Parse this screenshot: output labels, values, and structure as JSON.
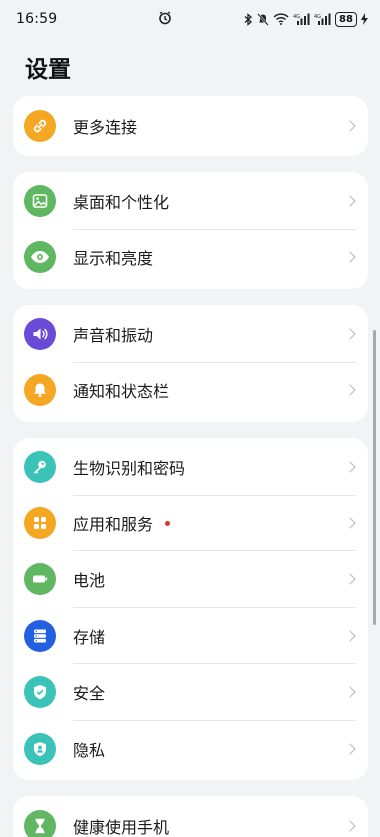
{
  "status_bar": {
    "time": "16:59",
    "battery": "88",
    "icons": [
      "alarm-icon",
      "bluetooth-icon",
      "mute-icon",
      "wifi-icon",
      "signal-icon",
      "signal-icon",
      "charging-icon"
    ]
  },
  "page": {
    "title": "设置"
  },
  "groups": [
    {
      "items": [
        {
          "label": "更多连接",
          "icon": "link-icon",
          "color": "#f5a623"
        }
      ]
    },
    {
      "items": [
        {
          "label": "桌面和个性化",
          "icon": "image-icon",
          "color": "#5fb761"
        },
        {
          "label": "显示和亮度",
          "icon": "eye-icon",
          "color": "#5fb761"
        }
      ]
    },
    {
      "items": [
        {
          "label": "声音和振动",
          "icon": "speaker-icon",
          "color": "#6a4bd8"
        },
        {
          "label": "通知和状态栏",
          "icon": "bell-icon",
          "color": "#f5a623"
        }
      ]
    },
    {
      "items": [
        {
          "label": "生物识别和密码",
          "icon": "key-icon",
          "color": "#3cc3b8"
        },
        {
          "label": "应用和服务",
          "icon": "apps-icon",
          "color": "#f5a623",
          "badge": "red-dot",
          "badge_color": "#e0322b"
        },
        {
          "label": "电池",
          "icon": "battery-icon",
          "color": "#5fb761"
        },
        {
          "label": "存储",
          "icon": "storage-icon",
          "color": "#2360e0"
        },
        {
          "label": "安全",
          "icon": "shield-icon",
          "color": "#3cc3b8"
        },
        {
          "label": "隐私",
          "icon": "privacy-icon",
          "color": "#3cc3b8"
        }
      ]
    },
    {
      "items": [
        {
          "label": "健康使用手机",
          "icon": "hourglass-icon",
          "color": "#5fb761"
        }
      ]
    }
  ]
}
